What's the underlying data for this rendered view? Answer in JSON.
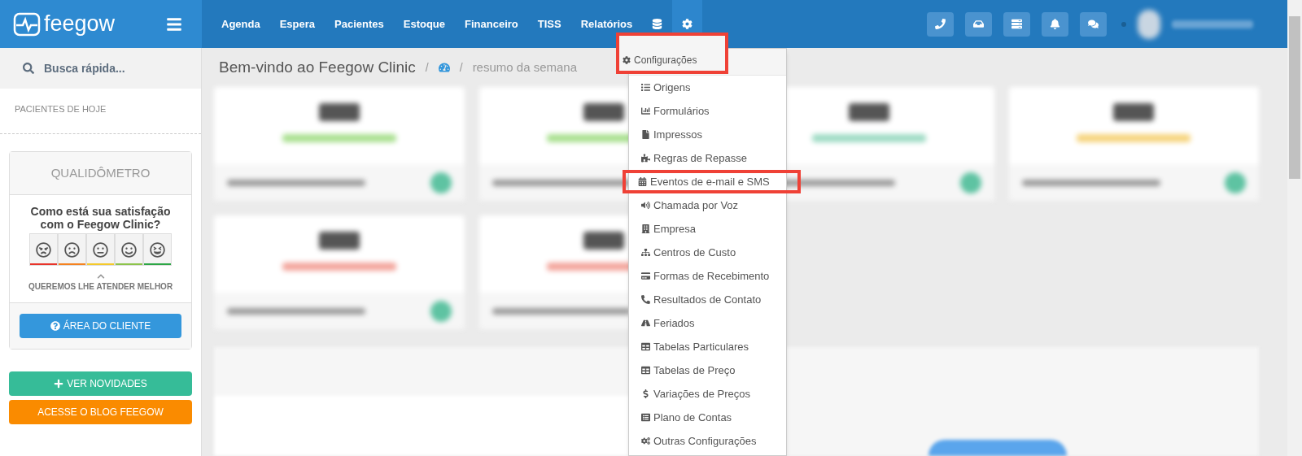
{
  "brand": {
    "name": "feegow"
  },
  "nav": [
    {
      "label": "Agenda"
    },
    {
      "label": "Espera"
    },
    {
      "label": "Pacientes"
    },
    {
      "label": "Estoque"
    },
    {
      "label": "Financeiro"
    },
    {
      "label": "TISS"
    },
    {
      "label": "Relatórios"
    }
  ],
  "nav_icons": [
    {
      "selected": false
    },
    {
      "selected": true
    }
  ],
  "sidebar": {
    "search": {
      "placeholder": "Busca rápida..."
    },
    "section": "PACIENTES DE HOJE",
    "qualidometro": {
      "title": "QUALIDÔMETRO",
      "question": "Como está sua satisfação com o Feegow Clinic?",
      "faces": [
        {
          "color": "#e8332a"
        },
        {
          "color": "#f5821f"
        },
        {
          "color": "#f4c92b"
        },
        {
          "color": "#8cc34b"
        },
        {
          "color": "#2ca645"
        }
      ],
      "hint": "QUEREMOS LHE ATENDER MELHOR",
      "button": "ÁREA DO CLIENTE"
    },
    "buttons": [
      {
        "kind": "news",
        "label": "VER NOVIDADES"
      },
      {
        "kind": "blog",
        "label": "ACESSE O BLOG FEEGOW"
      }
    ]
  },
  "breadcrumb": {
    "title": "Bem-vindo ao Feegow Clinic",
    "separator": "/",
    "current": "resumo da semana"
  },
  "dropdown": {
    "header": {
      "label": "Configurações",
      "highlighted": true
    },
    "items": [
      {
        "label": "Origens",
        "highlighted": false
      },
      {
        "label": "Formulários",
        "highlighted": false
      },
      {
        "label": "Impressos",
        "highlighted": false
      },
      {
        "label": "Regras de Repasse",
        "highlighted": false
      },
      {
        "label": "Eventos de e-mail e SMS",
        "highlighted": true
      },
      {
        "label": "Chamada por Voz",
        "highlighted": false
      },
      {
        "label": "Empresa",
        "highlighted": false
      },
      {
        "label": "Centros de Custo",
        "highlighted": false
      },
      {
        "label": "Formas de Recebimento",
        "highlighted": false
      },
      {
        "label": "Resultados de Contato",
        "highlighted": false
      },
      {
        "label": "Feriados",
        "highlighted": false
      },
      {
        "label": "Tabelas Particulares",
        "highlighted": false
      },
      {
        "label": "Tabelas de Preço",
        "highlighted": false
      },
      {
        "label": "Variações de Preços",
        "highlighted": false
      },
      {
        "label": "Plano de Contas",
        "highlighted": false
      },
      {
        "label": "Outras Configurações",
        "highlighted": false
      }
    ]
  }
}
